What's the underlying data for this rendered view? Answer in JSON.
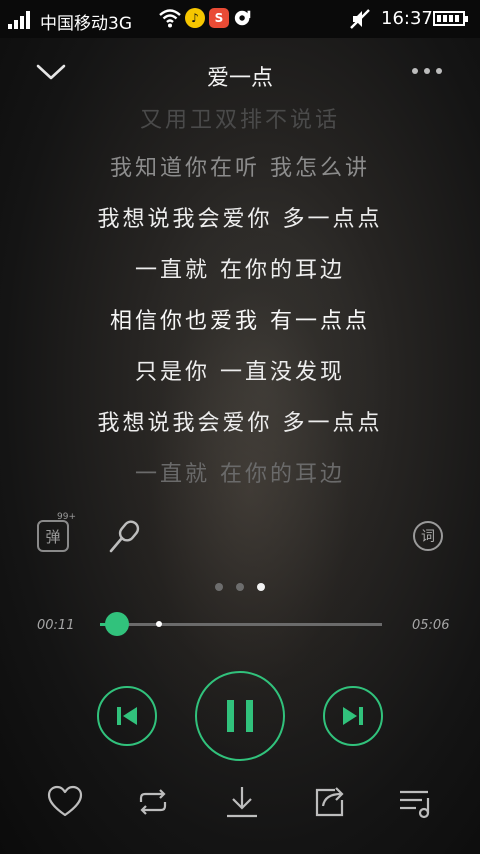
{
  "status_bar": {
    "carrier": "中国移动3G",
    "time": "16:37",
    "app_icons": [
      "qq-icon",
      "sogou-icon",
      "music-icon"
    ],
    "colors": {
      "qq": "#f6c600",
      "sogou": "#e94b35"
    }
  },
  "header": {
    "title": "爱一点",
    "back_icon": "chevron-down-icon",
    "more_icon": "more-dots-icon"
  },
  "lyrics": {
    "lines": [
      "又用卫双排不说话",
      "我知道你在听 我怎么讲",
      "我想说我会爱你 多一点点",
      "一直就 在你的耳边",
      "相信你也爱我 有一点点",
      "只是你 一直没发现",
      "我想说我会爱你 多一点点",
      "一直就 在你的耳边"
    ],
    "current_line_index": 4
  },
  "tools": {
    "danmu_label": "弹",
    "danmu_badge": "99+",
    "ci_label": "词"
  },
  "pager": {
    "count": 3,
    "active_index": 2
  },
  "progress": {
    "elapsed": "00:11",
    "total": "05:06",
    "played_fraction": 0.06,
    "buffered_fraction": 0.21
  },
  "colors": {
    "accent": "#31c27c"
  },
  "controls": {
    "prev_icon": "skip-previous-icon",
    "play_state_icon": "pause-icon",
    "next_icon": "skip-next-icon"
  },
  "bottom_bar": [
    "heart-icon",
    "repeat-icon",
    "download-icon",
    "share-icon",
    "playlist-icon"
  ]
}
